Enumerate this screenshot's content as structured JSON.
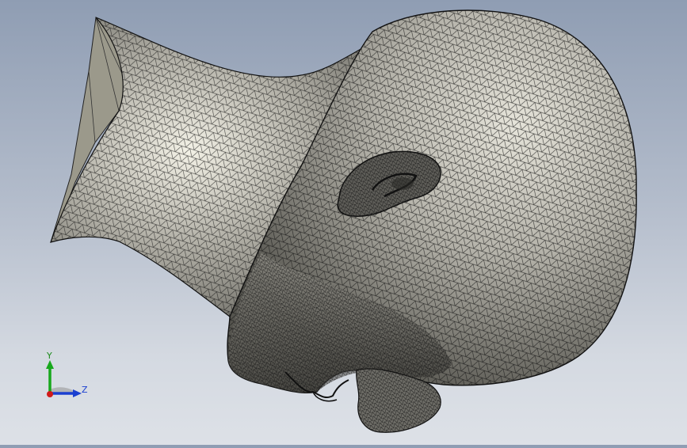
{
  "viewport": {
    "model_name": "",
    "background_top": "#8f9db3",
    "background_bottom": "#dde1e7",
    "mesh_color": "#000000",
    "surface_color": "#b8b6ad",
    "cut_face_color": "#9e9c8c"
  },
  "triad": {
    "y_label": "Y",
    "z_label": "Z",
    "y_color": "#17a81c",
    "z_color": "#1a3fd0",
    "x_color": "#d01a1a"
  }
}
